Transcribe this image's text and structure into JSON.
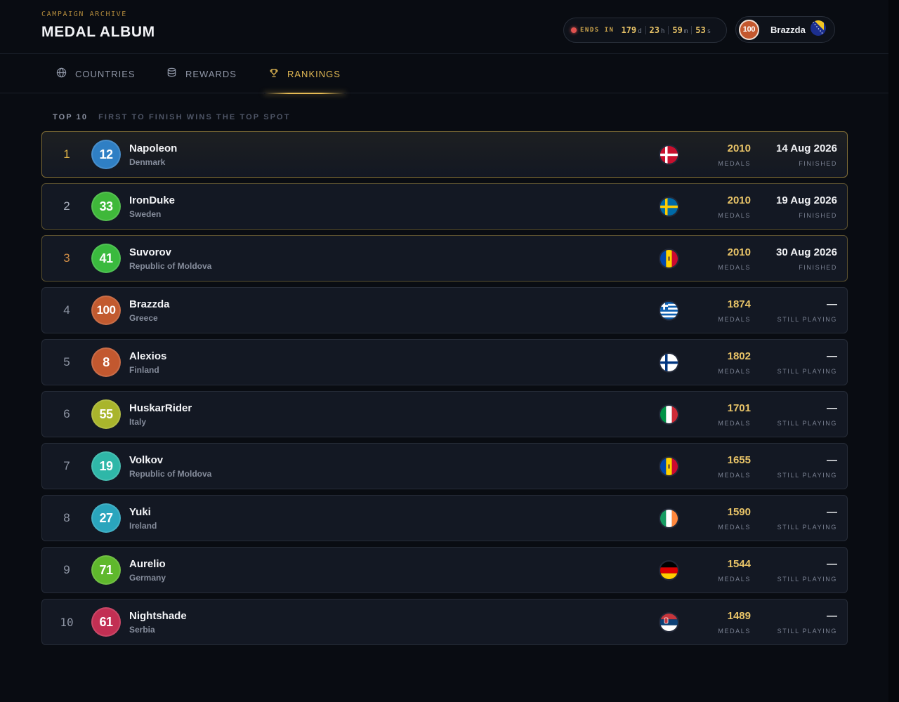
{
  "header": {
    "eyebrow": "CAMPAIGN ARCHIVE",
    "title": "MEDAL ALBUM",
    "timer": {
      "label": "ENDS IN",
      "days": "179",
      "days_unit": "d",
      "hours": "23",
      "hours_unit": "h",
      "minutes": "59",
      "minutes_unit": "m",
      "seconds": "53",
      "seconds_unit": "s"
    },
    "user": {
      "level": "100",
      "name": "Brazzda",
      "flag_icon": "bosnia-flag-icon"
    }
  },
  "tabs": [
    {
      "label": "COUNTRIES",
      "icon": "globe-icon",
      "active": false
    },
    {
      "label": "REWARDS",
      "icon": "coins-icon",
      "active": false
    },
    {
      "label": "RANKINGS",
      "icon": "trophy-icon",
      "active": true
    }
  ],
  "section": {
    "lead": "TOP 10",
    "sub": "FIRST TO FINISH WINS THE TOP SPOT"
  },
  "rows": [
    {
      "rank": "1",
      "level": "12",
      "name": "Napoleon",
      "country": "Denmark",
      "flag": "denmark",
      "medals": "2010",
      "medals_label": "MEDALS",
      "finish": "14 Aug 2026",
      "finish_label": "FINISHED",
      "avatar_color": "#2f7fc4"
    },
    {
      "rank": "2",
      "level": "33",
      "name": "IronDuke",
      "country": "Sweden",
      "flag": "sweden",
      "medals": "2010",
      "medals_label": "MEDALS",
      "finish": "19 Aug 2026",
      "finish_label": "FINISHED",
      "avatar_color": "#3fb83a"
    },
    {
      "rank": "3",
      "level": "41",
      "name": "Suvorov",
      "country": "Republic of Moldova",
      "flag": "moldova",
      "medals": "2010",
      "medals_label": "MEDALS",
      "finish": "30 Aug 2026",
      "finish_label": "FINISHED",
      "avatar_color": "#3aba3e"
    },
    {
      "rank": "4",
      "level": "100",
      "name": "Brazzda",
      "country": "Greece",
      "flag": "greece",
      "medals": "1874",
      "medals_label": "MEDALS",
      "finish": "—",
      "finish_label": "STILL PLAYING",
      "avatar_color": "#c25a2f"
    },
    {
      "rank": "5",
      "level": "8",
      "name": "Alexios",
      "country": "Finland",
      "flag": "finland",
      "medals": "1802",
      "medals_label": "MEDALS",
      "finish": "—",
      "finish_label": "STILL PLAYING",
      "avatar_color": "#c2582f"
    },
    {
      "rank": "6",
      "level": "55",
      "name": "HuskarRider",
      "country": "Italy",
      "flag": "italy",
      "medals": "1701",
      "medals_label": "MEDALS",
      "finish": "—",
      "finish_label": "STILL PLAYING",
      "avatar_color": "#a9b52c"
    },
    {
      "rank": "7",
      "level": "19",
      "name": "Volkov",
      "country": "Republic of Moldova",
      "flag": "moldova",
      "medals": "1655",
      "medals_label": "MEDALS",
      "finish": "—",
      "finish_label": "STILL PLAYING",
      "avatar_color": "#2fb7a8"
    },
    {
      "rank": "8",
      "level": "27",
      "name": "Yuki",
      "country": "Ireland",
      "flag": "ireland",
      "medals": "1590",
      "medals_label": "MEDALS",
      "finish": "—",
      "finish_label": "STILL PLAYING",
      "avatar_color": "#2aa5bd"
    },
    {
      "rank": "9",
      "level": "71",
      "name": "Aurelio",
      "country": "Germany",
      "flag": "germany",
      "medals": "1544",
      "medals_label": "MEDALS",
      "finish": "—",
      "finish_label": "STILL PLAYING",
      "avatar_color": "#5fb82c"
    },
    {
      "rank": "10",
      "level": "61",
      "name": "Nightshade",
      "country": "Serbia",
      "flag": "serbia",
      "medals": "1489",
      "medals_label": "MEDALS",
      "finish": "—",
      "finish_label": "STILL PLAYING",
      "avatar_color": "#c22f53"
    }
  ],
  "colors": {
    "accent": "#e9c468",
    "background": "#090c12",
    "row_bg": "#131823"
  }
}
